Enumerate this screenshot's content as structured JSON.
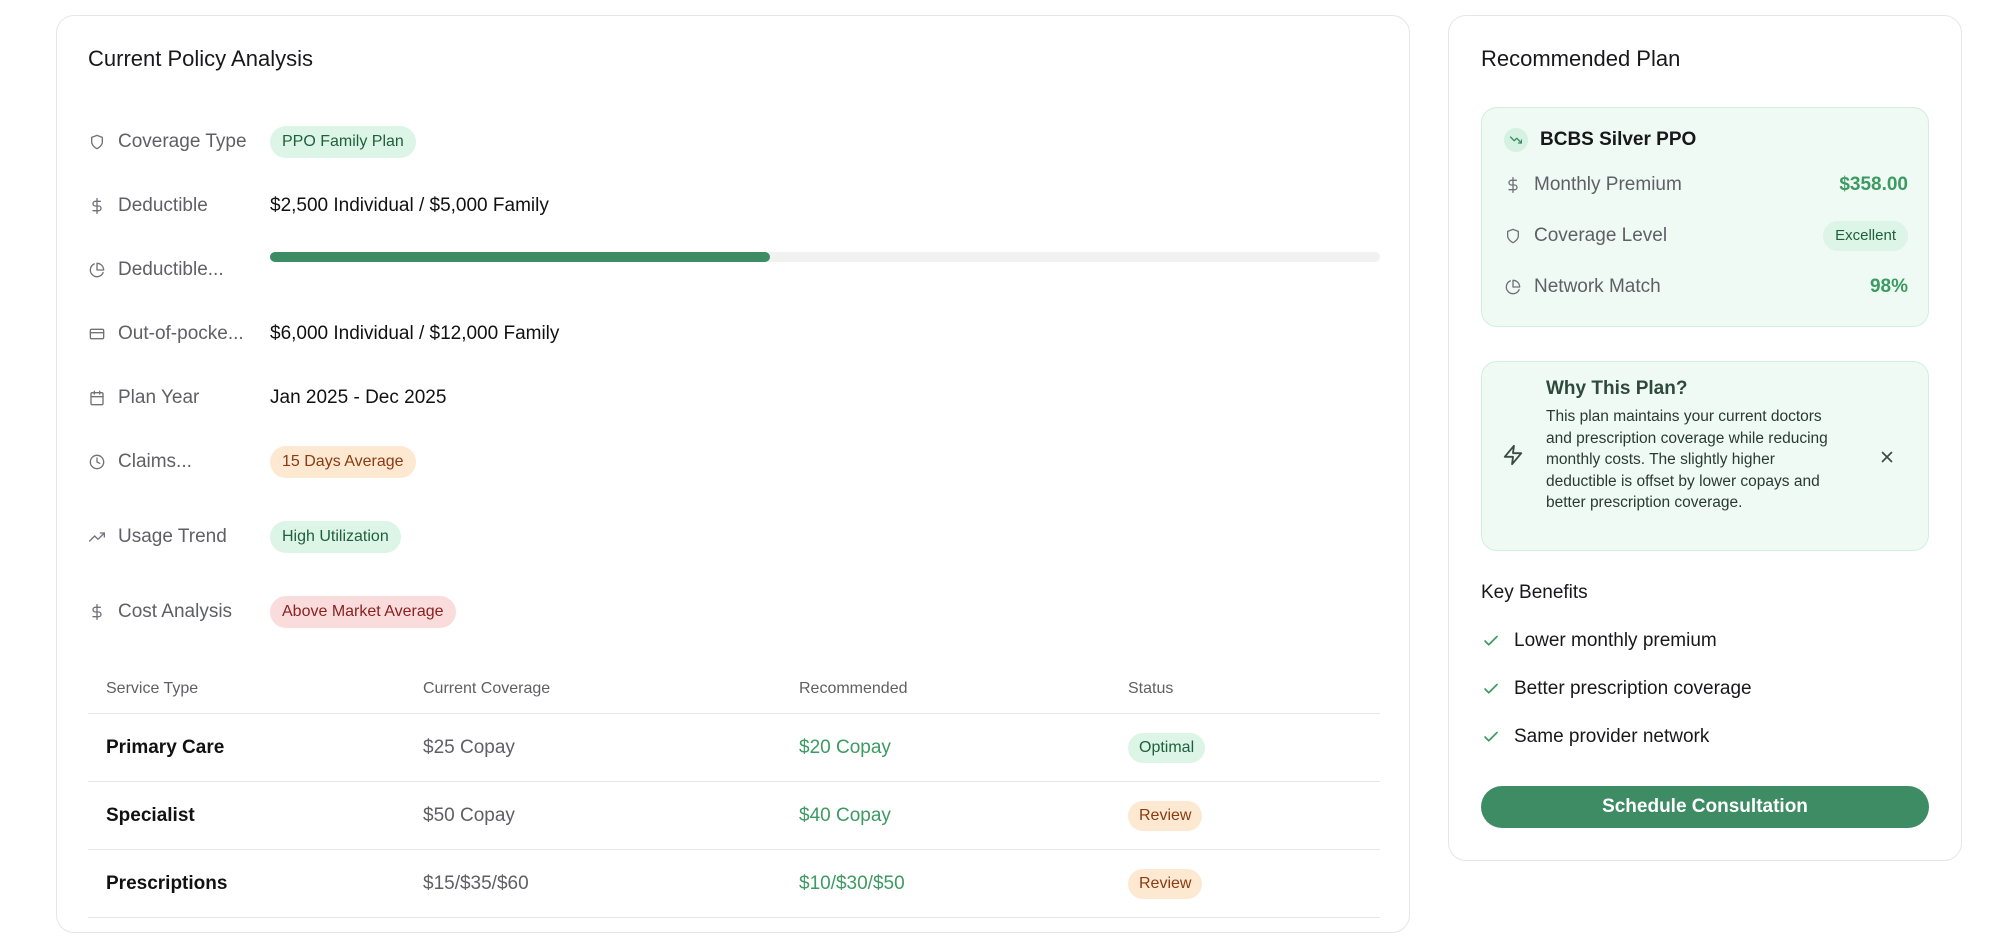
{
  "colors": {
    "accent": "#3d8c63",
    "accent_text": "#3d9a62",
    "badge_green_bg": "#dcf5e6",
    "badge_orange_bg": "#fde8d2",
    "badge_red_bg": "#fbdcdc"
  },
  "current": {
    "title": "Current Policy Analysis",
    "rows": [
      {
        "icon": "shield-icon",
        "label": "Coverage Type",
        "badge": "PPO Family Plan"
      },
      {
        "icon": "dollar-icon",
        "label": "Deductible",
        "value": "$2,500 Individual / $5,000 Family"
      },
      {
        "icon": "pie-chart-icon",
        "label": "Deductible...",
        "progress": 0.45
      },
      {
        "icon": "credit-card-icon",
        "label": "Out-of-pocke...",
        "value": "$6,000 Individual / $12,000 Family"
      },
      {
        "icon": "calendar-icon",
        "label": "Plan Year",
        "value": "Jan 2025 - Dec 2025"
      },
      {
        "icon": "clock-icon",
        "label": "Claims...",
        "badge": "15 Days Average"
      },
      {
        "icon": "trending-up-icon",
        "label": "Usage Trend",
        "badge": "High Utilization"
      },
      {
        "icon": "dollar-icon",
        "label": "Cost Analysis",
        "badge": "Above Market Average"
      }
    ],
    "table": {
      "headers": [
        "Service Type",
        "Current Coverage",
        "Recommended",
        "Status"
      ],
      "rows": [
        {
          "service": "Primary Care",
          "current": "$25 Copay",
          "recommended": "$20 Copay",
          "status": "Optimal"
        },
        {
          "service": "Specialist",
          "current": "$50 Copay",
          "recommended": "$40 Copay",
          "status": "Review"
        },
        {
          "service": "Prescriptions",
          "current": "$15/$35/$60",
          "recommended": "$10/$30/$50",
          "status": "Review"
        }
      ]
    }
  },
  "recommended": {
    "title": "Recommended Plan",
    "plan_icon": "trending-down-icon",
    "plan_name": "BCBS Silver PPO",
    "metrics": [
      {
        "icon": "dollar-icon",
        "label": "Monthly Premium",
        "value": "$358.00"
      },
      {
        "icon": "shield-icon",
        "label": "Coverage Level",
        "badge": "Excellent"
      },
      {
        "icon": "pie-chart-icon",
        "label": "Network Match",
        "value": "98%"
      }
    ],
    "why": {
      "icon": "zap-icon",
      "title": "Why This Plan?",
      "text": "This plan maintains your current doctors and prescription coverage while reducing monthly costs. The slightly higher deductible is offset by lower copays and better prescription coverage."
    },
    "benefits_title": "Key Benefits",
    "benefits": [
      "Lower monthly premium",
      "Better prescription coverage",
      "Same provider network"
    ],
    "cta": "Schedule Consultation"
  }
}
